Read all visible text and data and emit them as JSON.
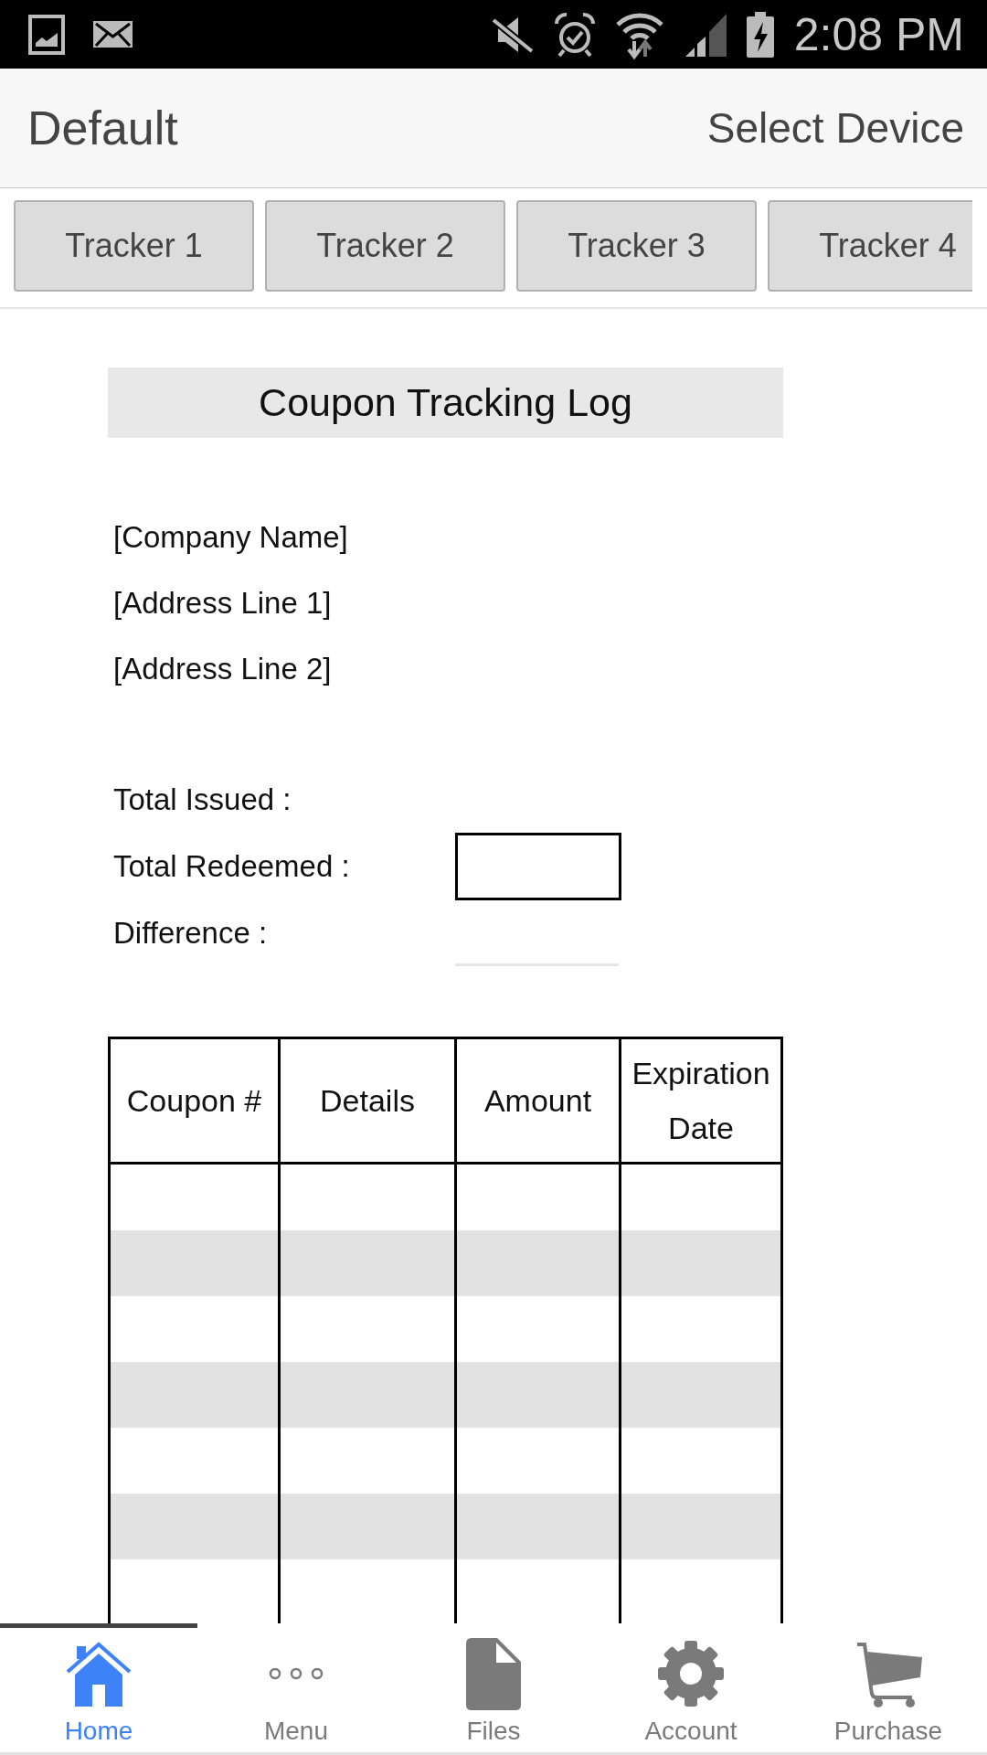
{
  "status_bar": {
    "time": "2:08 PM"
  },
  "header": {
    "title": "Default",
    "action": "Select Device"
  },
  "tabs": [
    {
      "label": "Tracker 1",
      "selected": false
    },
    {
      "label": "Tracker 2",
      "selected": false
    },
    {
      "label": "Tracker 3",
      "selected": false
    },
    {
      "label": "Tracker 4",
      "selected": false
    }
  ],
  "document": {
    "title": "Coupon Tracking Log",
    "address_lines": [
      "[Company Name]",
      "[Address Line 1]",
      "[Address Line 2]"
    ],
    "totals": [
      {
        "label": "Total Issued :",
        "kind": "plain"
      },
      {
        "label": "Total Redeemed :",
        "kind": "box"
      },
      {
        "label": "Difference :",
        "kind": "line"
      }
    ],
    "table": {
      "columns": [
        "Coupon #",
        "Details",
        "Amount",
        "Expiration Date"
      ],
      "rows": [
        {
          "shaded": false
        },
        {
          "shaded": true
        },
        {
          "shaded": false
        },
        {
          "shaded": true
        },
        {
          "shaded": false
        },
        {
          "shaded": true
        },
        {
          "shaded": false
        }
      ]
    }
  },
  "bottom_nav": [
    {
      "label": "Home",
      "selected": true
    },
    {
      "label": "Menu",
      "selected": false
    },
    {
      "label": "Files",
      "selected": false
    },
    {
      "label": "Account",
      "selected": false
    },
    {
      "label": "Purchase",
      "selected": false
    }
  ]
}
